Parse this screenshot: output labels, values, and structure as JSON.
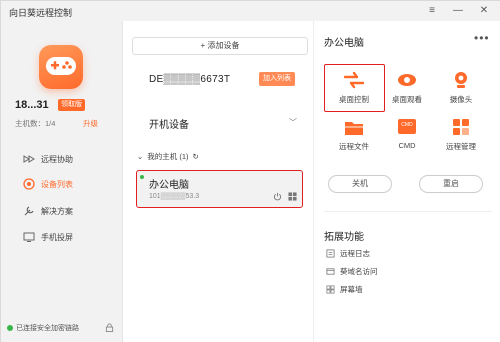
{
  "window": {
    "title": "向日葵远程控制"
  },
  "colors": {
    "accent": "#ff6a2b",
    "highlight": "#e02020",
    "online": "#3bb54a"
  },
  "sidebar": {
    "user_name": "18...31",
    "badge": "领取版",
    "hosts_label": "主机数：1/4",
    "upgrade": "升级",
    "nav": [
      {
        "label": "远程协助",
        "icon": "remote-assist-icon"
      },
      {
        "label": "设备列表",
        "icon": "device-list-icon",
        "active": true
      },
      {
        "label": "解决方案",
        "icon": "solution-icon"
      },
      {
        "label": "手机投屏",
        "icon": "screen-cast-icon"
      }
    ],
    "status": "已连接安全加密链路"
  },
  "middle": {
    "add_device": "+ 添加设备",
    "device_id": "DE▒▒▒▒▒6673T",
    "join_button": "加入列表",
    "section": "开机设备",
    "group": "我的主机 (1)",
    "device": {
      "name": "办公电脑",
      "ip": "101▒▒▒▒▒53.3"
    }
  },
  "right": {
    "title": "办公电脑",
    "tools": [
      {
        "label": "桌面控制",
        "icon": "desktop-control-icon"
      },
      {
        "label": "桌面观看",
        "icon": "desktop-view-icon"
      },
      {
        "label": "摄像头",
        "icon": "camera-icon"
      },
      {
        "label": "远程文件",
        "icon": "remote-file-icon"
      },
      {
        "label": "CMD",
        "icon": "cmd-icon"
      },
      {
        "label": "远程管理",
        "icon": "remote-manage-icon"
      }
    ],
    "shutdown": "关机",
    "restart": "重启",
    "ext_title": "拓展功能",
    "ext_items": [
      "远程日志",
      "葵域名访问",
      "屏幕墙"
    ]
  }
}
